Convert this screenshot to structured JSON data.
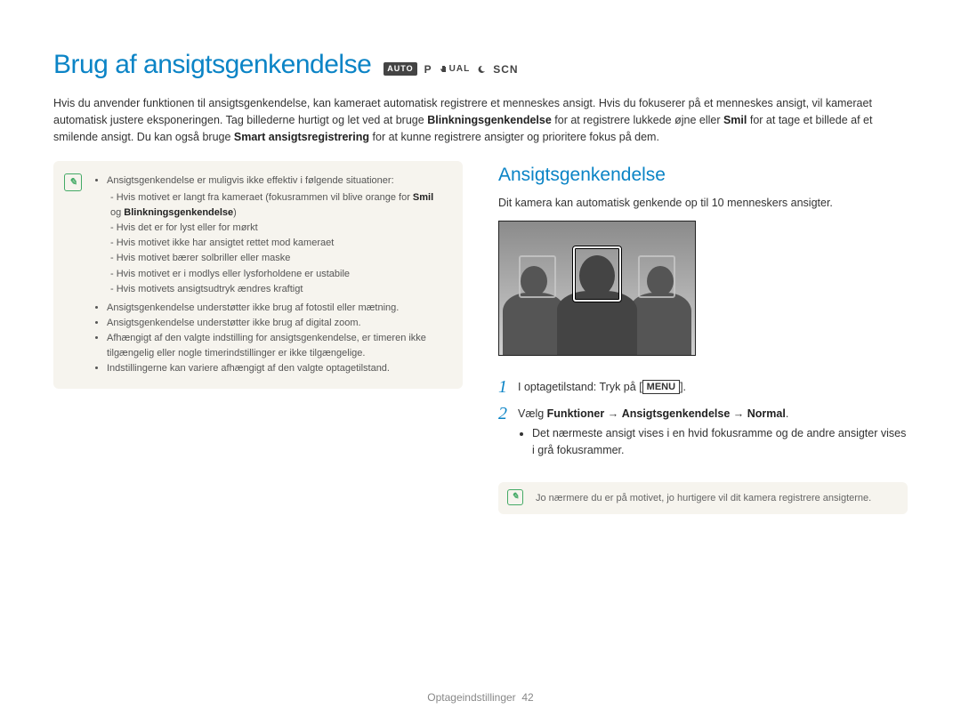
{
  "header": {
    "title": "Brug af ansigtsgenkendelse",
    "modes": {
      "auto": "AUTO",
      "p": "P",
      "dual": "UAL",
      "scn": "SCN"
    }
  },
  "intro": {
    "line1_a": "Hvis du anvender funktionen til ansigtsgenkendelse, kan kameraet automatisk registrere et menneskes ansigt. Hvis du fokuserer på et menneskes ansigt, vil kameraet automatisk justere eksponeringen. Tag billederne hurtigt og let ved at bruge ",
    "bold1": "Blinkningsgenkendelse",
    "line1_b": " for at registrere lukkede øjne eller ",
    "bold2": "Smil",
    "line1_c": " for at tage et billede af et smilende ansigt. Du kan også bruge ",
    "bold3": "Smart ansigtsregistrering",
    "line1_d": " for at kunne registrere ansigter og prioritere fokus på dem."
  },
  "note": {
    "b1": "Ansigtsgenkendelse er muligvis ikke effektiv i følgende situationer:",
    "s1_a": "Hvis motivet er langt fra kameraet (fokusrammen vil blive orange for ",
    "s1_bold1": "Smil",
    "s1_mid": " og ",
    "s1_bold2": "Blinkningsgenkendelse",
    "s1_b": ")",
    "s2": "Hvis det er for lyst eller for mørkt",
    "s3": "Hvis motivet ikke har ansigtet rettet mod kameraet",
    "s4": "Hvis motivet bærer solbriller eller maske",
    "s5": "Hvis motivet er i modlys eller lysforholdene er ustabile",
    "s6": "Hvis motivets ansigtsudtryk ændres kraftigt",
    "b2": "Ansigtsgenkendelse understøtter ikke brug af fotostil eller mætning.",
    "b3": "Ansigtsgenkendelse understøtter ikke brug af digital zoom.",
    "b4": "Afhængigt af den valgte indstilling for ansigtsgenkendelse, er timeren ikke tilgængelig eller nogle timerindstillinger er ikke tilgængelige.",
    "b5": "Indstillingerne kan variere afhængigt af den valgte optagetilstand."
  },
  "section": {
    "title": "Ansigtsgenkendelse",
    "desc": "Dit kamera kan automatisk genkende op til 10 menneskers ansigter."
  },
  "steps": {
    "num1": "1",
    "step1_a": "I optagetilstand: Tryk på [",
    "step1_menu": "MENU",
    "step1_b": "].",
    "num2": "2",
    "step2_a": "Vælg ",
    "step2_b1": "Funktioner",
    "step2_arrow1": " → ",
    "step2_b2": "Ansigtsgenkendelse",
    "step2_arrow2": " → ",
    "step2_b3": "Normal",
    "step2_end": ".",
    "sub": "Det nærmeste ansigt vises i en hvid fokusramme og de andre ansigter vises i grå fokusrammer."
  },
  "small_note": "Jo nærmere du er på motivet, jo hurtigere vil dit kamera registrere ansigterne.",
  "footer": {
    "section": "Optageindstillinger",
    "page": "42"
  }
}
